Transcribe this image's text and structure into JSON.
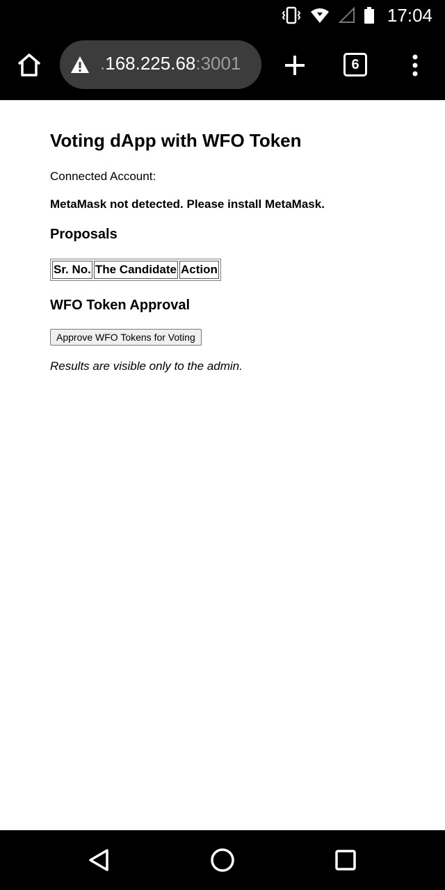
{
  "status_bar": {
    "time": "17:04",
    "icons": [
      "vibrate-icon",
      "wifi-icon",
      "signal-icon",
      "battery-icon"
    ]
  },
  "browser": {
    "url_prefix": ".",
    "url_host": "168.225.68",
    "url_port": ":3001",
    "tab_count": "6",
    "icons": [
      "home-icon",
      "warning-icon",
      "plus-icon",
      "tab-switcher-icon",
      "more-vert-icon"
    ]
  },
  "page": {
    "title": "Voting dApp with WFO Token",
    "connected_label": "Connected Account:",
    "metamask_message": "MetaMask not detected. Please install MetaMask.",
    "proposals_heading": "Proposals",
    "table_headers": [
      "Sr. No.",
      "The Candidate",
      "Action"
    ],
    "approval_heading": "WFO Token Approval",
    "approve_button": "Approve WFO Tokens for Voting",
    "results_note": "Results are visible only to the admin."
  },
  "nav_bar": {
    "icons": [
      "back-icon",
      "home-circle-icon",
      "recents-icon"
    ]
  },
  "colors": {
    "system_bar": "#000000",
    "omnibox": "#3c3c3c",
    "page_background": "#ffffff"
  }
}
